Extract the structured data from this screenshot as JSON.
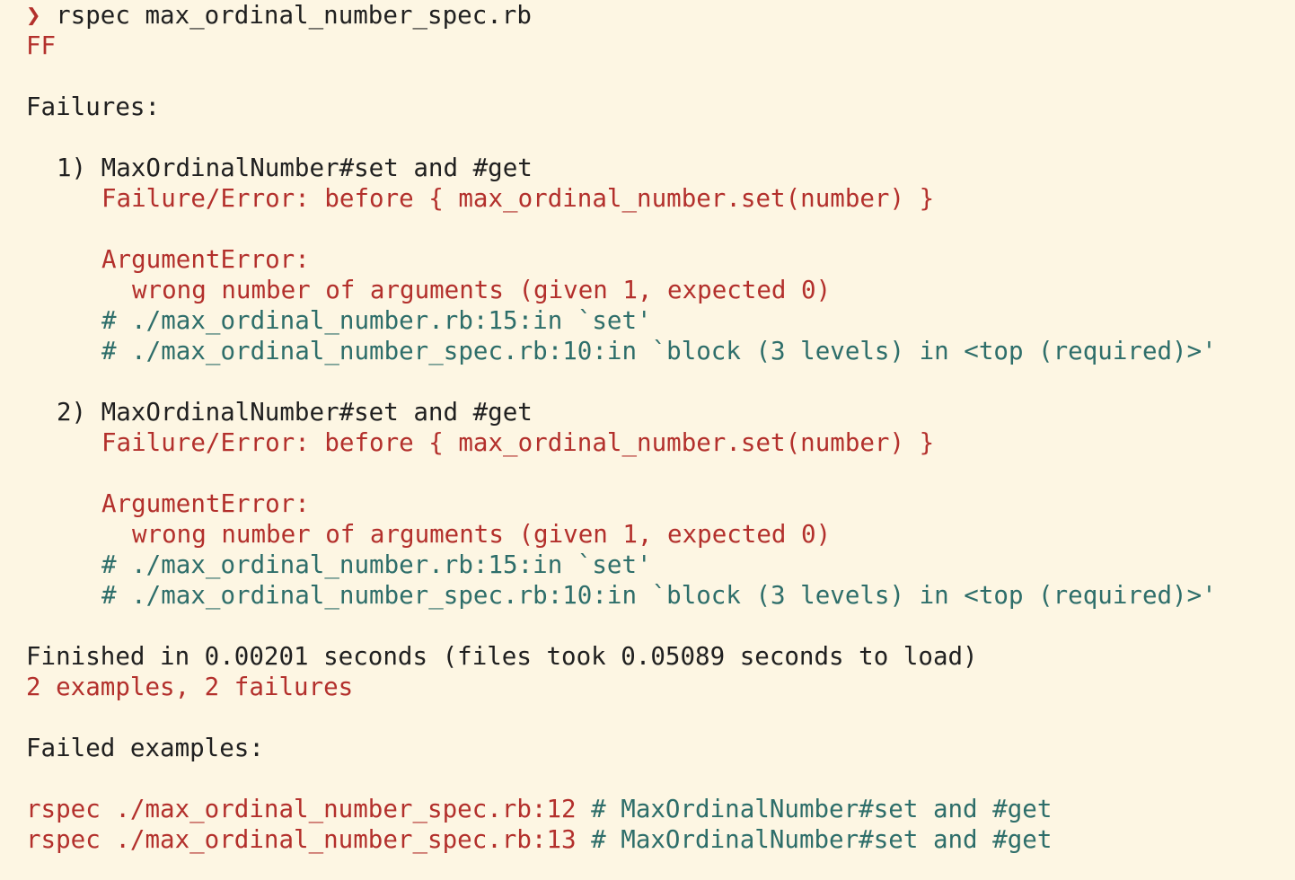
{
  "terminal": {
    "prompt_symbol": "❯",
    "command": " rspec max_ordinal_number_spec.rb",
    "progress": "FF",
    "failures_heading": "Failures:",
    "failures": [
      {
        "header": "1) MaxOrdinalNumber#set and #get",
        "failure_error": "Failure/Error: before { max_ordinal_number.set(number) }",
        "error_class": "ArgumentError:",
        "error_message": "wrong number of arguments (given 1, expected 0)",
        "backtrace": [
          "# ./max_ordinal_number.rb:15:in `set'",
          "# ./max_ordinal_number_spec.rb:10:in `block (3 levels) in <top (required)>'"
        ]
      },
      {
        "header": "2) MaxOrdinalNumber#set and #get",
        "failure_error": "Failure/Error: before { max_ordinal_number.set(number) }",
        "error_class": "ArgumentError:",
        "error_message": "wrong number of arguments (given 1, expected 0)",
        "backtrace": [
          "# ./max_ordinal_number.rb:15:in `set'",
          "# ./max_ordinal_number_spec.rb:10:in `block (3 levels) in <top (required)>'"
        ]
      }
    ],
    "finished": "Finished in 0.00201 seconds (files took 0.05089 seconds to load)",
    "summary": "2 examples, 2 failures",
    "failed_examples_heading": "Failed examples:",
    "failed_examples": [
      {
        "command": "rspec ./max_ordinal_number_spec.rb:12",
        "comment": " # MaxOrdinalNumber#set and #get"
      },
      {
        "command": "rspec ./max_ordinal_number_spec.rb:13",
        "comment": " # MaxOrdinalNumber#set and #get"
      }
    ]
  },
  "colors": {
    "background": "#fdf6e3",
    "text": "#202020",
    "error_red": "#b3302c",
    "backtrace_teal": "#2e6e6a"
  }
}
